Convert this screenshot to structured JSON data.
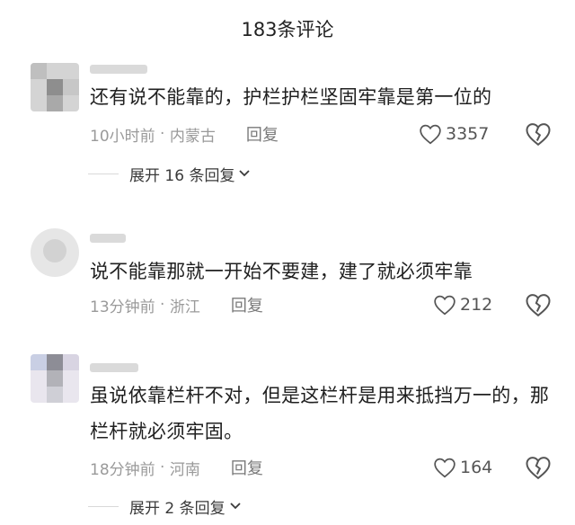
{
  "header": {
    "title": "183条评论"
  },
  "comments": [
    {
      "content": "还有说不能靠的，护栏护栏坚固牢靠是第一位的",
      "time": "10小时前",
      "location": "内蒙古",
      "reply_label": "回复",
      "likes": "3357",
      "expand_label": "展开 16 条回复"
    },
    {
      "content": "说不能靠那就一开始不要建，建了就必须牢靠",
      "time": "13分钟前",
      "location": "浙江",
      "reply_label": "回复",
      "likes": "212"
    },
    {
      "content": "虽说依靠栏杆不对，但是这栏杆是用来抵挡万一的，那栏杆就必须牢固。",
      "time": "18分钟前",
      "location": "河南",
      "reply_label": "回复",
      "likes": "164",
      "expand_label": "展开 2 条回复"
    }
  ],
  "colors": {
    "text": "#1f1f1f",
    "meta": "#9a9a9a",
    "divider": "#d9d9d9"
  }
}
